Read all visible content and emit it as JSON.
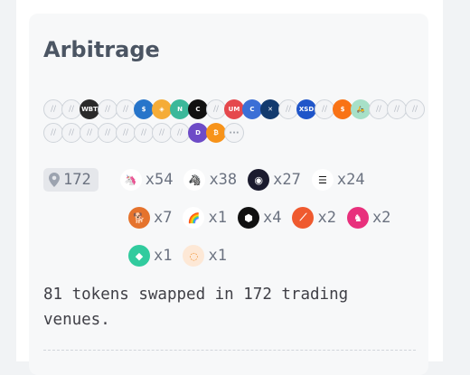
{
  "card": {
    "title": "Arbitrage"
  },
  "tokens": {
    "rows": [
      [
        {
          "name": "placeholder-token-icon",
          "kind": "blank",
          "text": "//"
        },
        {
          "name": "placeholder-token-icon",
          "kind": "blank",
          "text": "//"
        },
        {
          "name": "wbt-token-icon",
          "kind": "logo",
          "text": "WBT",
          "color": "#2a2a2a"
        },
        {
          "name": "placeholder-token-icon",
          "kind": "blank",
          "text": "//"
        },
        {
          "name": "placeholder-token-icon",
          "kind": "blank",
          "text": "//"
        },
        {
          "name": "usdc-token-icon",
          "kind": "logo",
          "text": "$",
          "color": "#2775ca"
        },
        {
          "name": "dai-token-icon",
          "kind": "logo",
          "text": "◈",
          "color": "#f5ac37"
        },
        {
          "name": "near-token-icon",
          "kind": "logo",
          "text": "N",
          "color": "#3bb89a"
        },
        {
          "name": "token-c-icon",
          "kind": "logo",
          "text": "C",
          "color": "#111111"
        },
        {
          "name": "placeholder-token-icon",
          "kind": "blank",
          "text": "//"
        },
        {
          "name": "red-token-icon",
          "kind": "logo",
          "text": "UM",
          "color": "#e5484d"
        },
        {
          "name": "blue-c-token-icon",
          "kind": "logo",
          "text": "C",
          "color": "#3b6fd6"
        },
        {
          "name": "x-token-icon",
          "kind": "logo",
          "text": "✕",
          "color": "#123a6e"
        },
        {
          "name": "placeholder-token-icon",
          "kind": "blank",
          "text": "//"
        },
        {
          "name": "xsgd-token-icon",
          "kind": "logo",
          "text": "XSD",
          "color": "#1f55c9"
        },
        {
          "name": "placeholder-token-icon",
          "kind": "blank",
          "text": "//"
        },
        {
          "name": "colorful-token-icon",
          "kind": "logo",
          "text": "$",
          "color": "#f97316"
        },
        {
          "name": "scooter-token-icon",
          "kind": "logo",
          "text": "🛵",
          "color": "#a7e0c8"
        },
        {
          "name": "placeholder-token-icon",
          "kind": "blank",
          "text": "//"
        },
        {
          "name": "placeholder-token-icon",
          "kind": "blank",
          "text": "//"
        },
        {
          "name": "placeholder-token-icon",
          "kind": "blank",
          "text": "//"
        }
      ],
      [
        {
          "name": "placeholder-token-icon",
          "kind": "blank",
          "text": "//"
        },
        {
          "name": "placeholder-token-icon",
          "kind": "blank",
          "text": "//"
        },
        {
          "name": "placeholder-token-icon",
          "kind": "blank",
          "text": "//"
        },
        {
          "name": "placeholder-token-icon",
          "kind": "blank",
          "text": "//"
        },
        {
          "name": "placeholder-token-icon",
          "kind": "blank",
          "text": "//"
        },
        {
          "name": "placeholder-token-icon",
          "kind": "blank",
          "text": "//"
        },
        {
          "name": "placeholder-token-icon",
          "kind": "blank",
          "text": "//"
        },
        {
          "name": "placeholder-token-icon",
          "kind": "blank",
          "text": "//"
        },
        {
          "name": "d-token-icon",
          "kind": "logo",
          "text": "D",
          "color": "#6d4bc7"
        },
        {
          "name": "bitcoin-token-icon",
          "kind": "logo",
          "text": "₿",
          "color": "#f7931a"
        },
        {
          "name": "more-tokens-icon",
          "kind": "more",
          "text": "···"
        }
      ]
    ]
  },
  "venues": {
    "total": "172",
    "rows": [
      [
        {
          "name": "uniswap-venue",
          "icon": "🦄",
          "color": "#ffffff",
          "fg": "#ff007a",
          "count": "x54"
        },
        {
          "name": "unicorn-venue",
          "icon": "🦓",
          "color": "#ffffff",
          "fg": "#222222",
          "count": "x38"
        },
        {
          "name": "pancake-venue",
          "icon": "◉",
          "color": "#1b1b2e",
          "fg": "#ffffff",
          "count": "x27"
        },
        {
          "name": "stack-venue",
          "icon": "☰",
          "color": "#ffffff",
          "fg": "#111111",
          "count": "x24"
        }
      ],
      [
        {
          "name": "shiba-venue",
          "icon": "🐕",
          "color": "#e5732d",
          "fg": "#ffffff",
          "count": "x7"
        },
        {
          "name": "rainbow-venue",
          "icon": "🌈",
          "color": "#ffffff",
          "fg": "#ff4d88",
          "count": "x1"
        },
        {
          "name": "bancor-venue",
          "icon": "⬢",
          "color": "#111111",
          "fg": "#ffffff",
          "count": "x4"
        },
        {
          "name": "sushi-venue",
          "icon": "⟋",
          "color": "#ef5a2f",
          "fg": "#ffffff",
          "count": "x2"
        },
        {
          "name": "pink-venue",
          "icon": "♞",
          "color": "#e8307c",
          "fg": "#ffffff",
          "count": "x2"
        }
      ],
      [
        {
          "name": "kyber-venue",
          "icon": "◆",
          "color": "#31cb9e",
          "fg": "#ffffff",
          "count": "x1"
        },
        {
          "name": "swirl-venue",
          "icon": "◌",
          "color": "#fde8d6",
          "fg": "#f08a24",
          "count": "x1"
        }
      ]
    ]
  },
  "summary": "81 tokens swapped in 172 trading venues."
}
